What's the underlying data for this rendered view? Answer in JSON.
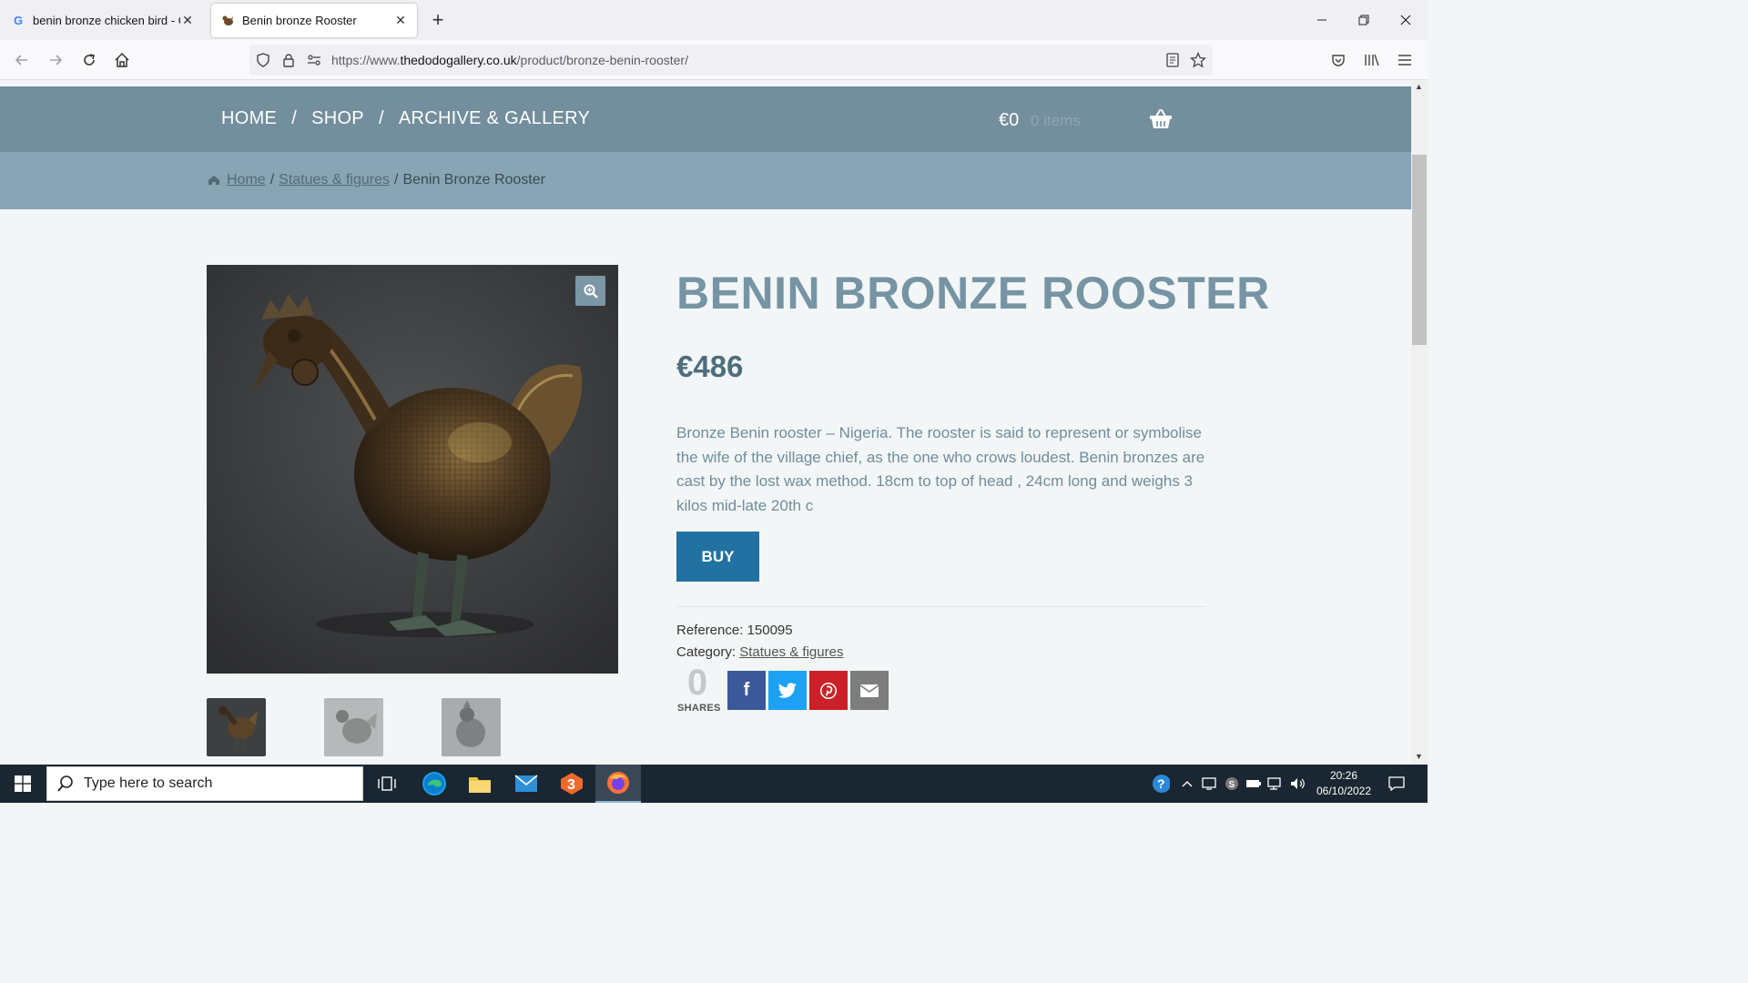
{
  "browser": {
    "tabs": [
      {
        "label": "benin bronze chicken bird - Goo",
        "favicon": "google-g-icon",
        "active": false
      },
      {
        "label": "Benin bronze Rooster",
        "favicon": "rooster-favicon",
        "active": true
      }
    ],
    "url_prefix": "https://www.",
    "url_domain": "thedodogallery.co.uk",
    "url_path": "/product/bronze-benin-rooster/"
  },
  "site": {
    "nav": [
      "HOME",
      "SHOP",
      "ARCHIVE & GALLERY"
    ],
    "nav_separator": "/",
    "cart_amount": "€0",
    "cart_items": "0 items"
  },
  "breadcrumb": {
    "home": "Home",
    "category": "Statues & figures",
    "current": "Benin Bronze Rooster",
    "separator": "/"
  },
  "product": {
    "title": "BENIN BRONZE ROOSTER",
    "price": "€486",
    "description": "Bronze Benin rooster – Nigeria. The rooster is said to represent or symbolise the wife of the village chief, as the one who crows loudest. Benin bronzes are cast by the lost wax method. 18cm to top of head , 24cm long and weighs 3 kilos mid-late 20th c",
    "buy_label": "BUY",
    "reference_label": "Reference:",
    "reference_value": "150095",
    "category_label": "Category:",
    "category_value": "Statues & figures",
    "shares_count": "0",
    "shares_label": "SHARES",
    "share_buttons": [
      {
        "name": "facebook",
        "color": "#3b5998"
      },
      {
        "name": "twitter",
        "color": "#1da1f2"
      },
      {
        "name": "pinterest",
        "color": "#cb2027"
      },
      {
        "name": "email",
        "color": "#7d7d7d"
      }
    ],
    "thumbnail_count": 3
  },
  "taskbar": {
    "search_placeholder": "Type here to search",
    "time": "20:26",
    "date": "06/10/2022"
  },
  "colors": {
    "topbar": "#738e9c",
    "crumbbar": "#87a5b4",
    "title": "#7694a3",
    "buy": "#2272a1"
  }
}
